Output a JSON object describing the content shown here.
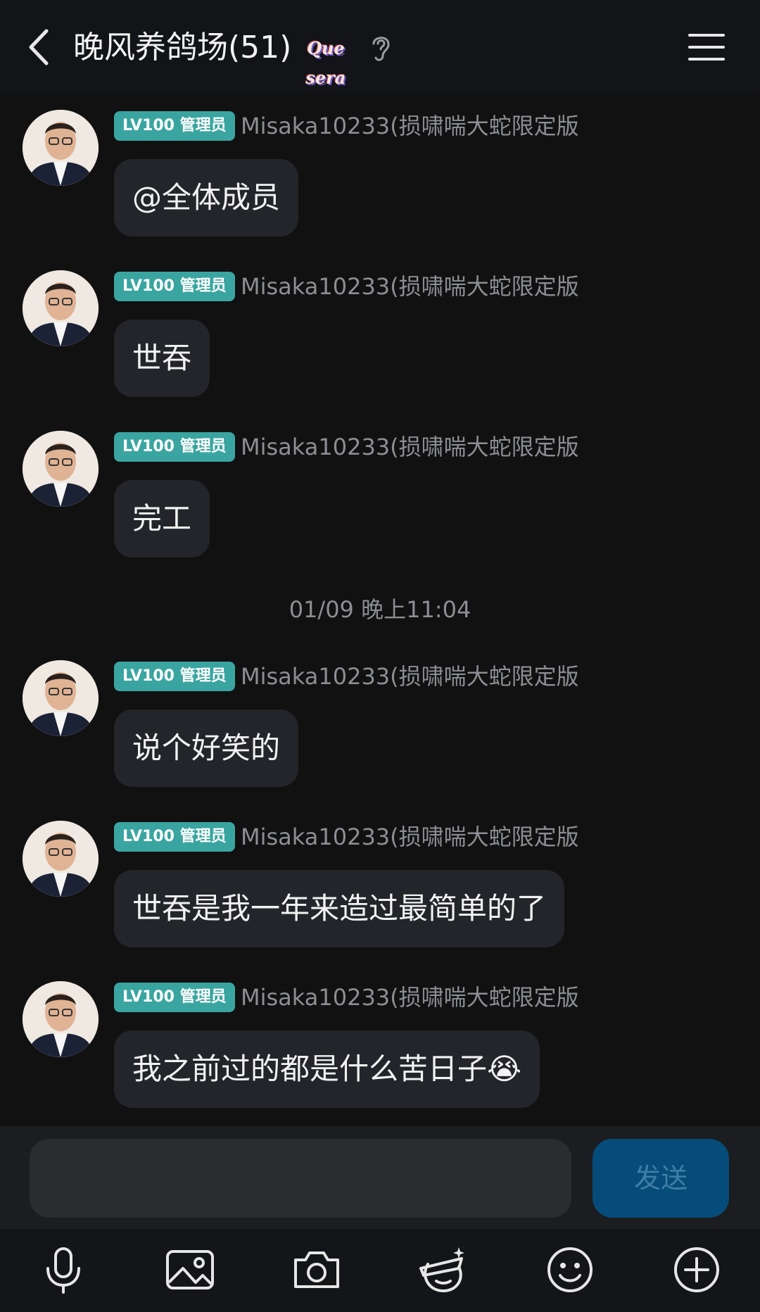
{
  "header": {
    "title": "晚风养鸽场(51)",
    "badge_text": "Que sera",
    "icons": {
      "back": "chevron-left-icon",
      "ear": "ear-icon",
      "menu": "hamburger-menu-icon"
    }
  },
  "messages": [
    {
      "level": "LV100 管理员",
      "name": "Misaka10233(损啸喘大蛇限定版",
      "text": "@全体成员"
    },
    {
      "level": "LV100 管理员",
      "name": "Misaka10233(损啸喘大蛇限定版",
      "text": "世吞"
    },
    {
      "level": "LV100 管理员",
      "name": "Misaka10233(损啸喘大蛇限定版",
      "text": "完工"
    },
    {
      "level": "LV100 管理员",
      "name": "Misaka10233(损啸喘大蛇限定版",
      "text": "说个好笑的"
    },
    {
      "level": "LV100 管理员",
      "name": "Misaka10233(损啸喘大蛇限定版",
      "text": "世吞是我一年来造过最简单的了"
    },
    {
      "level": "LV100 管理员",
      "name": "Misaka10233(损啸喘大蛇限定版",
      "text": "我之前过的都是什么苦日子😭"
    }
  ],
  "timestamp": "01/09 晚上11:04",
  "input": {
    "value": "",
    "placeholder": "",
    "send_label": "发送"
  },
  "toolbar": [
    "microphone-icon",
    "image-icon",
    "camera-icon",
    "magic-face-icon",
    "emoji-icon",
    "plus-circle-icon"
  ],
  "colors": {
    "badge": "#3aa5a0",
    "bubble": "#23252a",
    "send_button": "#064c7a",
    "background": "#111112"
  }
}
